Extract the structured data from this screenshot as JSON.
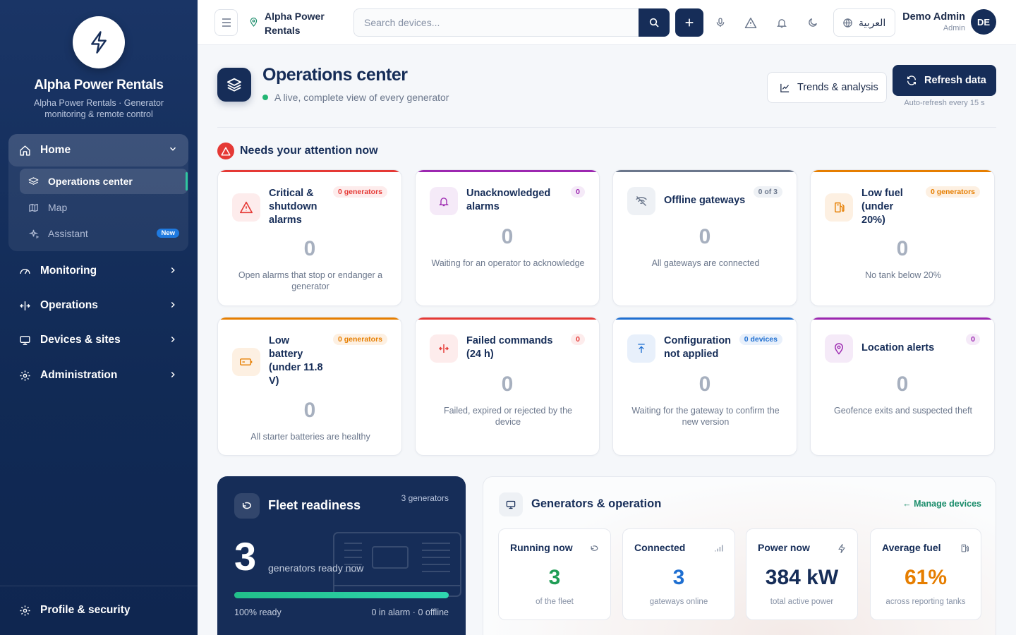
{
  "app": {
    "brand_name": "Alpha Power Rentals",
    "brand_tagline": "Alpha Power Rentals · Generator monitoring & remote control"
  },
  "sidebar": {
    "home": {
      "label": "Home",
      "icon": "home-icon"
    },
    "sub_items": [
      {
        "label": "Operations center",
        "icon": "layers-icon",
        "active": true
      },
      {
        "label": "Map",
        "icon": "map-icon"
      },
      {
        "label": "Assistant",
        "icon": "sparkles-icon",
        "badge": "New"
      }
    ],
    "items": [
      {
        "label": "Monitoring",
        "icon": "gauge-icon"
      },
      {
        "label": "Operations",
        "icon": "operations-icon"
      },
      {
        "label": "Devices & sites",
        "icon": "monitor-icon"
      },
      {
        "label": "Administration",
        "icon": "gear-icon"
      }
    ],
    "footer": {
      "label": "Profile & security",
      "icon": "gear-icon"
    }
  },
  "topbar": {
    "location": "Alpha Power Rentals",
    "search_placeholder": "Search devices...",
    "language": "العربية",
    "user_name": "Demo Admin",
    "user_role": "Admin",
    "avatar_initials": "DE"
  },
  "header": {
    "title": "Operations center",
    "subtitle": "A live, complete view of every generator",
    "trends_label": "Trends & analysis",
    "refresh_label": "Refresh data",
    "auto_refresh": "Auto-refresh every 15 s"
  },
  "attention": {
    "title": "Needs your attention now",
    "cards": [
      {
        "title": "Critical & shutdown alarms",
        "badge": "0 generators",
        "value": "0",
        "desc": "Open alarms that stop or endanger a generator",
        "color": "#e53935"
      },
      {
        "title": "Unacknowledged alarms",
        "badge": "0",
        "value": "0",
        "desc": "Waiting for an operator to acknowledge",
        "color": "#9c27b0"
      },
      {
        "title": "Offline gateways",
        "badge": "0 of 3",
        "value": "0",
        "desc": "All gateways are connected",
        "color": "#6b778c"
      },
      {
        "title": "Low fuel (under 20%)",
        "badge": "0 generators",
        "value": "0",
        "desc": "No tank below 20%",
        "color": "#e67e00"
      },
      {
        "title": "Low battery (under 11.8 V)",
        "badge": "0 generators",
        "value": "0",
        "desc": "All starter batteries are healthy",
        "color": "#e67e00"
      },
      {
        "title": "Failed commands (24 h)",
        "badge": "0",
        "value": "0",
        "desc": "Failed, expired or rejected by the device",
        "color": "#e53935"
      },
      {
        "title": "Configuration not applied",
        "badge": "0 devices",
        "value": "0",
        "desc": "Waiting for the gateway to confirm the new version",
        "color": "#1f6fd1"
      },
      {
        "title": "Location alerts",
        "badge": "0",
        "value": "0",
        "desc": "Geofence exits and suspected theft",
        "color": "#9c27b0"
      }
    ]
  },
  "fleet": {
    "title": "Fleet readiness",
    "count_label": "3 generators",
    "ready_value": "3",
    "ready_label": "generators ready now",
    "ready_fraction": 1.0,
    "ready_text": "100% ready",
    "status_text": "0 in alarm · 0 offline"
  },
  "generators": {
    "title": "Generators & operation",
    "manage_link": "← Manage devices",
    "stats": [
      {
        "title": "Running now",
        "value": "3",
        "desc": "of the fleet",
        "color": "#1f9d55",
        "icon": "running-icon"
      },
      {
        "title": "Connected",
        "value": "3",
        "desc": "gateways online",
        "color": "#1f6fd1",
        "icon": "signal-icon"
      },
      {
        "title": "Power now",
        "value": "384 kW",
        "desc": "total active power",
        "color": "#162d58",
        "icon": "bolt-icon"
      },
      {
        "title": "Average fuel",
        "value": "61%",
        "desc": "across reporting tanks",
        "color": "#e67e00",
        "icon": "fuel-icon"
      }
    ]
  }
}
